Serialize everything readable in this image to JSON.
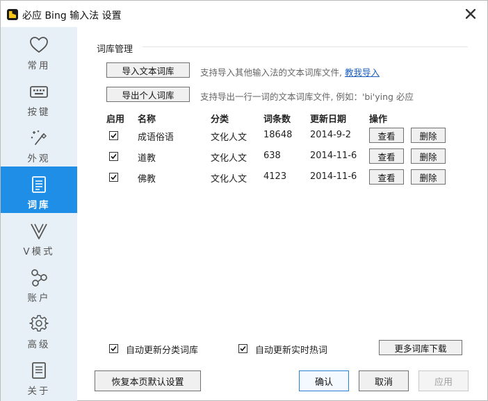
{
  "window": {
    "title": "必应 Bing 输入法 设置"
  },
  "sidebar": {
    "items": [
      {
        "label": "常用",
        "icon": "heart-icon",
        "active": false
      },
      {
        "label": "按键",
        "icon": "keyboard-icon",
        "active": false
      },
      {
        "label": "外观",
        "icon": "magic-wand-icon",
        "active": false
      },
      {
        "label": "词库",
        "icon": "document-list-icon",
        "active": true
      },
      {
        "label": "V模式",
        "icon": "v-mode-icon",
        "active": false
      },
      {
        "label": "账户",
        "icon": "share-nodes-icon",
        "active": false
      },
      {
        "label": "高级",
        "icon": "gear-icon",
        "active": false
      },
      {
        "label": "关于",
        "icon": "info-document-icon",
        "active": false
      }
    ]
  },
  "dict": {
    "section_title": "词库管理",
    "import_button": "导入文本词库",
    "import_hint": "支持导入其他输入法的文本词库文件,",
    "import_link": "教我导入",
    "export_button": "导出个人词库",
    "export_hint": "支持导出一行一词的文本词库文件, 例如：'bi'ying 必应",
    "columns": {
      "enabled": "启用",
      "name": "名称",
      "category": "分类",
      "count": "词条数",
      "updated": "更新日期",
      "actions": "操作"
    },
    "rows": [
      {
        "enabled": true,
        "name": "成语俗语",
        "category": "文化人文",
        "count": "18648",
        "updated": "2014-9-2",
        "view": "查看",
        "delete": "删除"
      },
      {
        "enabled": true,
        "name": "道教",
        "category": "文化人文",
        "count": "638",
        "updated": "2014-11-6",
        "view": "查看",
        "delete": "删除"
      },
      {
        "enabled": true,
        "name": "佛教",
        "category": "文化人文",
        "count": "4123",
        "updated": "2014-11-6",
        "view": "查看",
        "delete": "删除"
      }
    ],
    "auto_update_category": {
      "label": "自动更新分类词库",
      "checked": true
    },
    "auto_update_hot": {
      "label": "自动更新实时热词",
      "checked": true
    },
    "more_download": "更多词库下载"
  },
  "footer": {
    "restore_defaults": "恢复本页默认设置",
    "ok": "确认",
    "cancel": "取消",
    "apply": "应用"
  },
  "colors": {
    "sidebar_bg": "#e7f0f6",
    "active_bg": "#1f8ee6",
    "link": "#1a5fbf"
  }
}
